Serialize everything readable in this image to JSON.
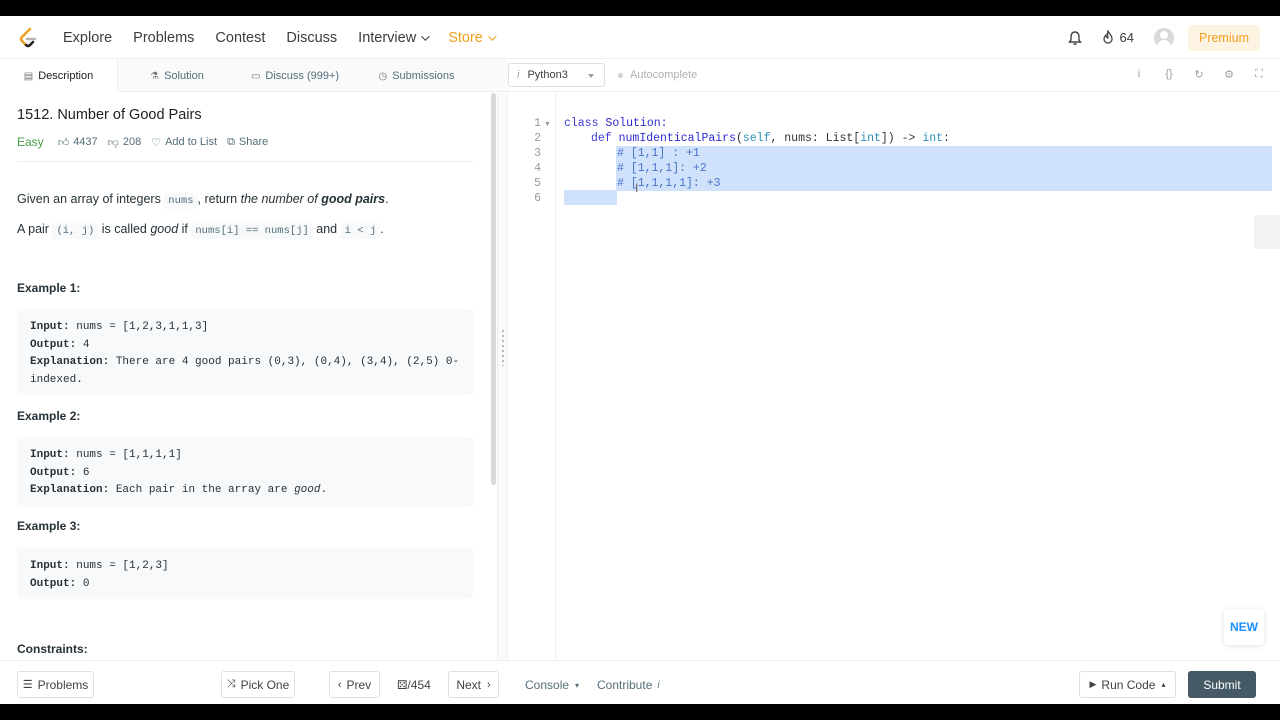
{
  "nav": {
    "links": [
      "Explore",
      "Problems",
      "Contest",
      "Discuss",
      "Interview",
      "Store"
    ],
    "streak": "64",
    "premium": "Premium"
  },
  "tabs": [
    "Description",
    "Solution",
    "Discuss (999+)",
    "Submissions"
  ],
  "problem": {
    "title": "1512. Number of Good Pairs",
    "difficulty": "Easy",
    "likes": "4437",
    "dislikes": "208",
    "add_to_list": "Add to List",
    "share": "Share",
    "desc1": {
      "a": "Given an array of integers ",
      "code": "nums",
      "b": ", return ",
      "c": "the number of ",
      "d": "good pairs",
      "e": "."
    },
    "desc2": {
      "a": "A pair ",
      "code1": "(i, j)",
      "b": " is called ",
      "c": "good",
      "d": " if ",
      "code2": "nums[i] == nums[j]",
      "e": " and ",
      "code3": "i < j",
      "f": "."
    },
    "examples": [
      {
        "heading": "Example 1:",
        "input": "nums = [1,2,3,1,1,3]",
        "output": "4",
        "explanation_a": "There are 4 good pairs (0,3), (0,4), (3,4), (2,5) 0-",
        "explanation_b": "indexed."
      },
      {
        "heading": "Example 2:",
        "input": "nums = [1,1,1,1]",
        "output": "6",
        "explanation": "Each pair in the array are ",
        "explanation_em": "good",
        "explanation_end": "."
      },
      {
        "heading": "Example 3:",
        "input": "nums = [1,2,3]",
        "output": "0"
      }
    ],
    "labels": {
      "input": "Input:",
      "output": "Output:",
      "explanation": "Explanation:"
    },
    "constraints": "Constraints:"
  },
  "editor": {
    "language": "Python3",
    "autocomplete": "Autocomplete",
    "line_numbers": [
      "1",
      "2",
      "3",
      "4",
      "5",
      "6"
    ],
    "code": {
      "l1_kw": "class",
      "l1_name": "Solution:",
      "l2_kw": "def",
      "l2_fn": "numIdenticalPairs",
      "l2_self": "self",
      "l2_mid": ", nums: List[",
      "l2_int": "int",
      "l2_arrow": "]) -> ",
      "l2_ret": "int",
      "l2_end": ":",
      "l3": "# [1,1] : +1",
      "l4": "# [1,1,1]: +2",
      "l5": "# [1,1,1,1]: +3"
    },
    "new_badge": "NEW"
  },
  "bottom": {
    "problems": "Problems",
    "pick_one": "Pick One",
    "prev": "Prev",
    "page": "⚄/454",
    "next": "Next",
    "console": "Console",
    "contribute": "Contribute",
    "run_code": "Run Code",
    "submit": "Submit"
  }
}
